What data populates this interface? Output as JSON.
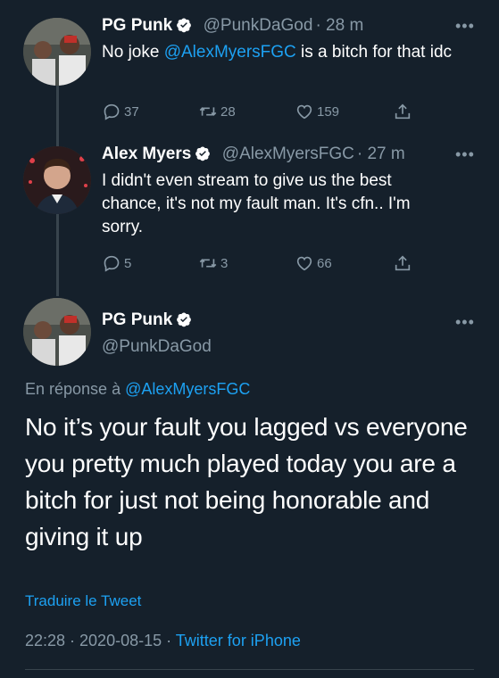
{
  "tweets": [
    {
      "name": "PG Punk",
      "handle": "@PunkDaGod",
      "time": "· 28 m",
      "text_before": "No joke ",
      "mention": "@AlexMyersFGC",
      "text_after": " is a bitch for that idc",
      "replies": "37",
      "retweets": "28",
      "likes": "159"
    },
    {
      "name": "Alex Myers",
      "handle": "@AlexMyersFGC",
      "time": "· 27 m",
      "text": "I didn't even stream to give us the best chance, it's not my fault man. It's cfn.. I'm sorry.",
      "replies": "5",
      "retweets": "3",
      "likes": "66"
    }
  ],
  "main": {
    "name": "PG Punk",
    "handle": "@PunkDaGod",
    "reply_prefix": "En réponse à ",
    "reply_to": "@AlexMyersFGC",
    "text": "No it’s your fault you lagged vs everyone you pretty much played today you are a bitch for just not being honorable and giving it up",
    "translate": "Traduire le Tweet",
    "timestamp": "22:28 · 2020-08-15 ·",
    "source": "Twitter for iPhone"
  },
  "icons": {
    "verified": "verified-badge-icon",
    "more": "more-dots-icon",
    "reply": "reply-icon",
    "retweet": "retweet-icon",
    "like": "heart-icon",
    "share": "share-icon"
  },
  "colors": {
    "background": "#15202b",
    "accent": "#1da1f2",
    "muted": "#8899a6",
    "divider": "#38444d"
  }
}
